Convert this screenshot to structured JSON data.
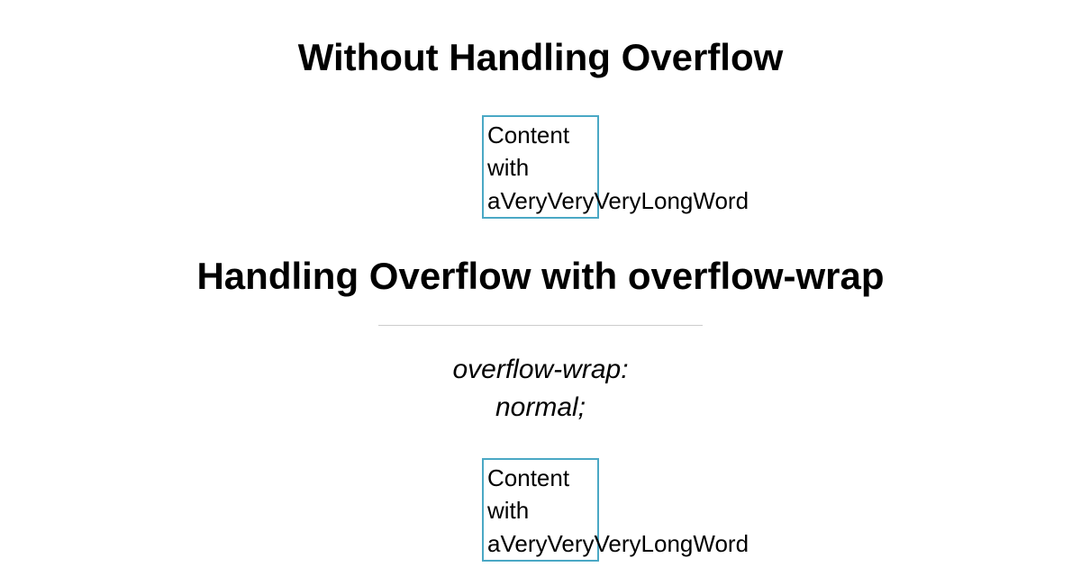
{
  "heading1": "Without Handling Overflow",
  "heading2": "Handling Overflow with overflow-wrap",
  "subtitle_line1": "overflow-wrap:",
  "subtitle_line2": "normal;",
  "box_line1": "Content",
  "box_line2": "with",
  "box_line3": "aVeryVeryVeryLongWord",
  "box2_line1": "Content",
  "box2_line2": "with",
  "box2_line3": "aVeryVeryVeryLongWord"
}
